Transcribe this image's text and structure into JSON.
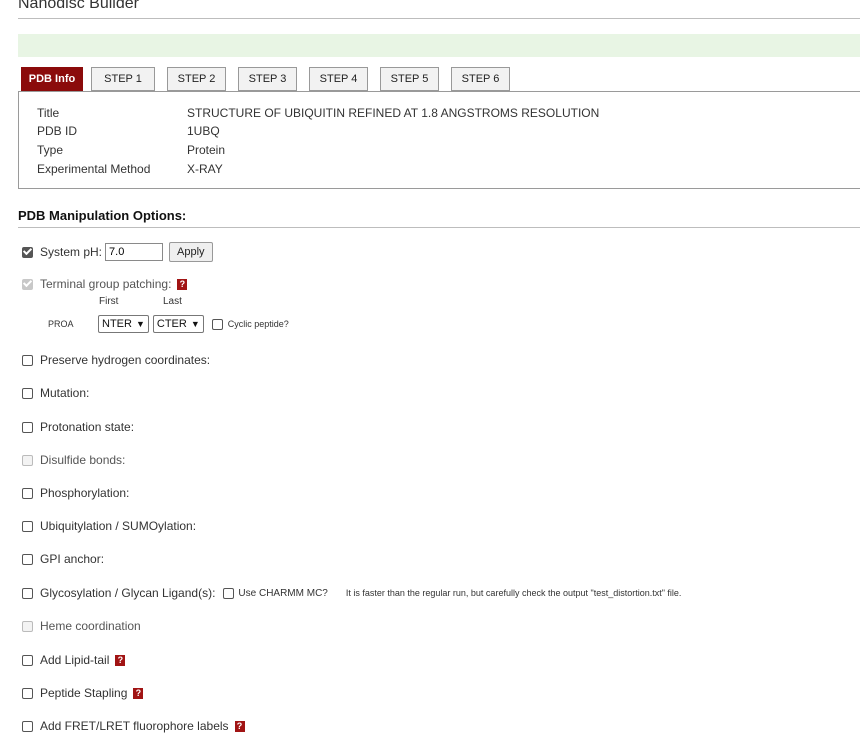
{
  "header": {
    "title": "Nanodisc Builder"
  },
  "tabs": [
    {
      "label": "PDB Info",
      "active": true
    },
    {
      "label": "STEP 1"
    },
    {
      "label": "STEP 2"
    },
    {
      "label": "STEP 3"
    },
    {
      "label": "STEP 4"
    },
    {
      "label": "STEP 5"
    },
    {
      "label": "STEP 6"
    }
  ],
  "pdb_info": {
    "rows": [
      {
        "label": "Title",
        "value": "STRUCTURE OF UBIQUITIN REFINED AT 1.8 ANGSTROMS RESOLUTION"
      },
      {
        "label": "PDB ID",
        "value": "1UBQ"
      },
      {
        "label": "Type",
        "value": "Protein"
      },
      {
        "label": "Experimental Method",
        "value": "X-RAY"
      }
    ]
  },
  "manipulation": {
    "heading": "PDB Manipulation Options:",
    "system_ph": {
      "label": "System pH:",
      "value": "7.0",
      "apply_label": "Apply",
      "checked": true
    },
    "terminal": {
      "label": "Terminal group patching:",
      "first_label": "First",
      "last_label": "Last",
      "chain": "PROA",
      "first_value": "NTER",
      "last_value": "CTER",
      "cyclic_label": "Cyclic peptide?"
    },
    "options": {
      "preserve_h": "Preserve hydrogen coordinates:",
      "mutation": "Mutation:",
      "protonation": "Protonation state:",
      "disulfide": "Disulfide bonds:",
      "phosphorylation": "Phosphorylation:",
      "ubiquitylation": "Ubiquitylation / SUMOylation:",
      "gpi": "GPI anchor:",
      "glycosylation": "Glycosylation / Glycan Ligand(s):",
      "charmm_mc": "Use CHARMM MC?",
      "glyco_note": "It is faster than the regular run, but carefully check the output \"test_distortion.txt\" file.",
      "heme": "Heme coordination",
      "lipid_tail": "Add Lipid-tail",
      "stapling": "Peptide Stapling",
      "fret": "Add FRET/LRET fluorophore labels"
    },
    "help_glyph": "?"
  }
}
